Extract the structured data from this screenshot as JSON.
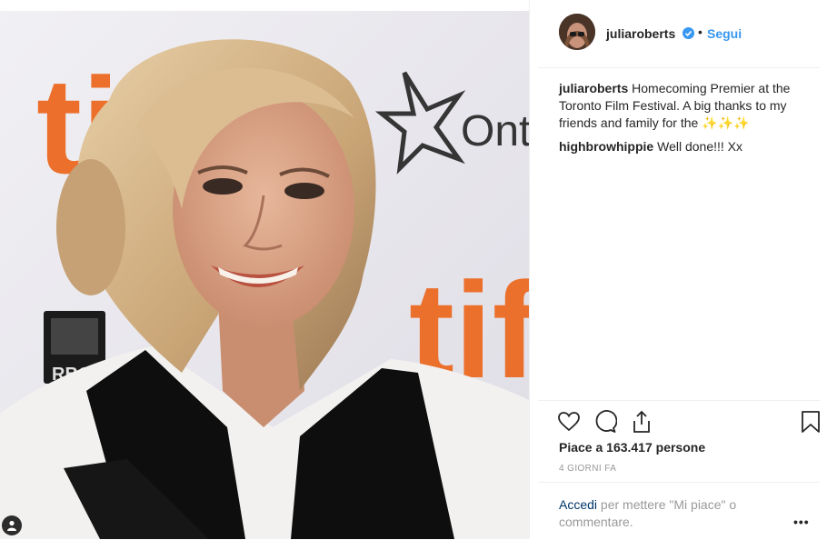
{
  "post": {
    "author": "juliaroberts",
    "follow_label": "Segui",
    "separator": "•",
    "verified_icon": "verified-badge-icon",
    "accent_color": "#3897f0"
  },
  "comments": [
    {
      "user": "juliaroberts",
      "text": "Homecoming Premier at the Toronto Film Festival. A big thanks to my friends and family for the",
      "emoji": "✨✨✨"
    },
    {
      "user": "highbrowhippie",
      "text": "Well done!!! Xx"
    }
  ],
  "actions": {
    "like_icon": "heart-icon",
    "comment_icon": "comment-icon",
    "share_icon": "share-icon",
    "save_icon": "bookmark-icon"
  },
  "likes_text": "Piace a 163.417 persone",
  "time_ago": "4 GIORNI FA",
  "footer": {
    "login_link": "Accedi",
    "login_rest": " per mettere \"Mi piace\" o commentare.",
    "more_label": "•••"
  },
  "photo": {
    "backdrop_texts": {
      "tiff_top": "tif",
      "ontario": "Ont",
      "tiff_bottom": "tif",
      "rbc": "RBC"
    }
  }
}
